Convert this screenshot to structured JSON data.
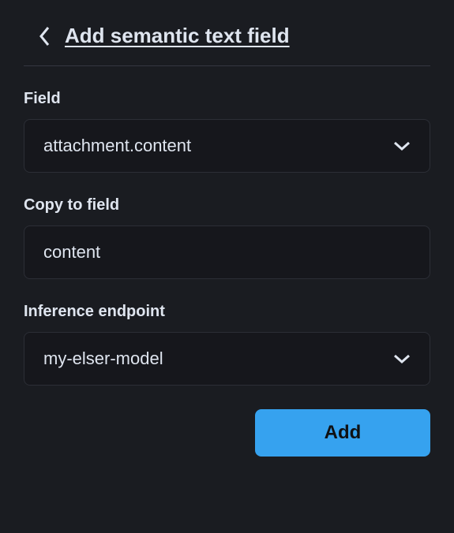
{
  "header": {
    "title": "Add semantic text field"
  },
  "form": {
    "field": {
      "label": "Field",
      "value": "attachment.content"
    },
    "copy_to_field": {
      "label": "Copy to field",
      "value": "content"
    },
    "inference_endpoint": {
      "label": "Inference endpoint",
      "value": "my-elser-model"
    }
  },
  "actions": {
    "add_label": "Add"
  }
}
